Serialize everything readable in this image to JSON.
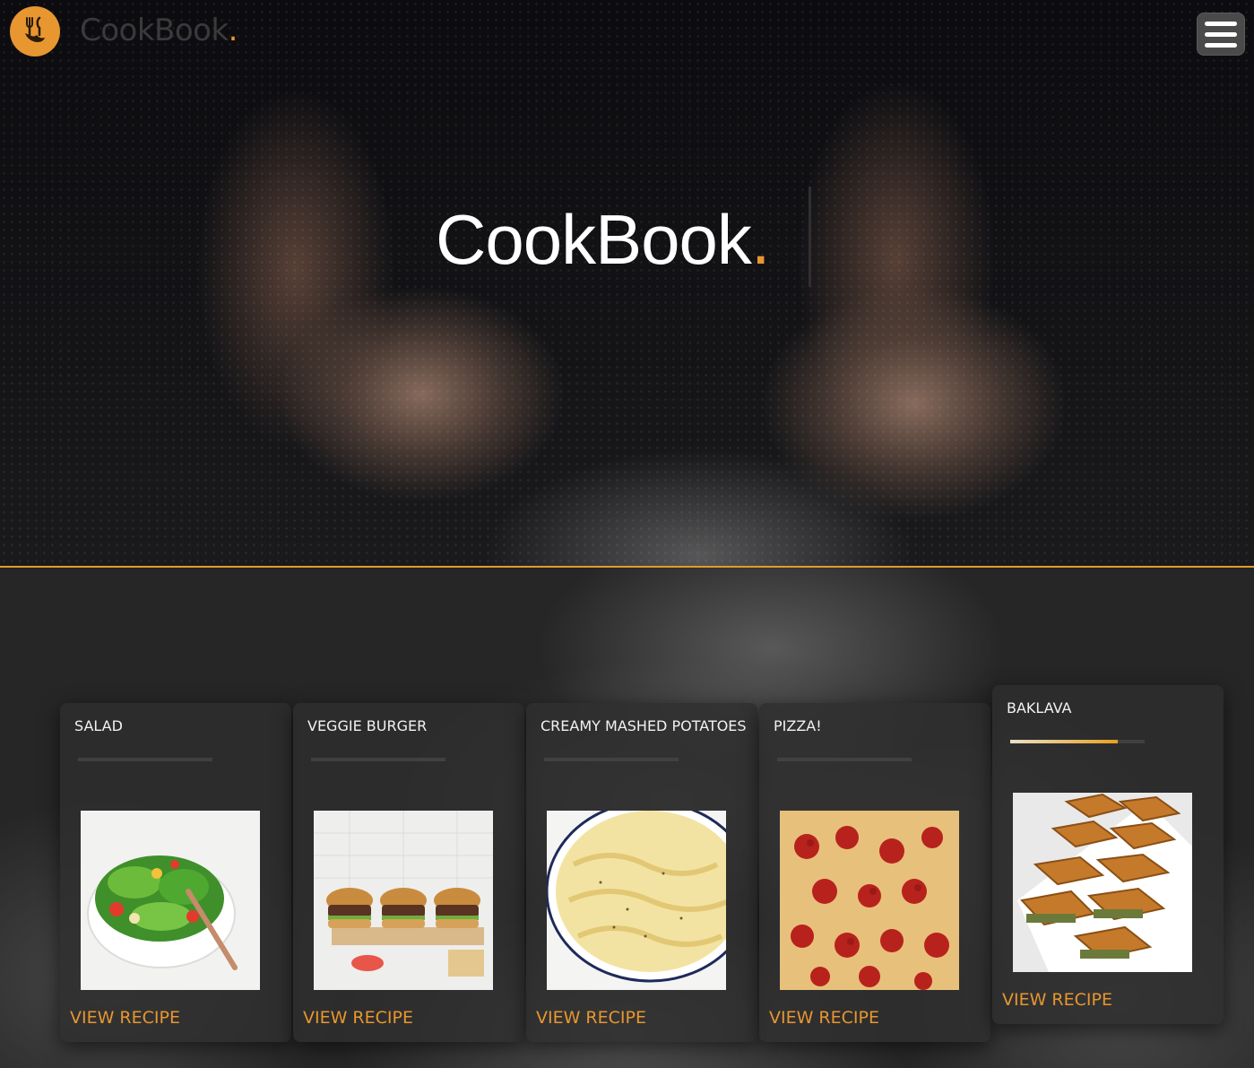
{
  "header": {
    "brand_name": "CookBook",
    "brand_dot": ".",
    "logo_icon": "cutlery-hand-icon",
    "menu_icon": "hamburger-menu-icon"
  },
  "hero": {
    "title": "CookBook",
    "title_dot": "."
  },
  "cards": [
    {
      "title": "SALAD",
      "link": "VIEW RECIPE",
      "image": "salad-bowl-image",
      "underline_progress": 0
    },
    {
      "title": "VEGGIE BURGER",
      "link": "VIEW RECIPE",
      "image": "veggie-burgers-image",
      "underline_progress": 0
    },
    {
      "title": "CREAMY MASHED POTATOES",
      "link": "VIEW RECIPE",
      "image": "mashed-potatoes-image",
      "underline_progress": 0
    },
    {
      "title": "PIZZA!",
      "link": "VIEW RECIPE",
      "image": "pepperoni-pizza-image",
      "underline_progress": 0
    },
    {
      "title": "BAKLAVA",
      "link": "VIEW RECIPE",
      "image": "baklava-image",
      "underline_progress": 0.8
    }
  ],
  "colors": {
    "accent": "#e8962f",
    "background": "#262626",
    "card": "#2e2e2e",
    "text": "#ffffff"
  }
}
